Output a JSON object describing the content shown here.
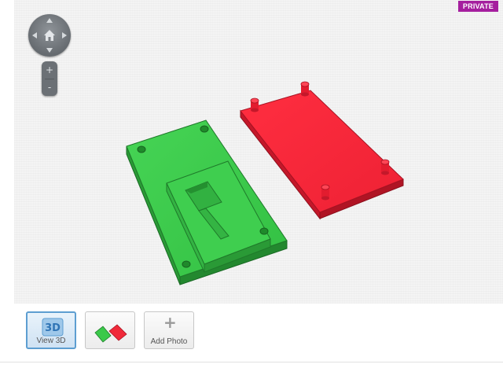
{
  "badge": {
    "private": "PRIVATE"
  },
  "navigation": {
    "home_icon": "home-icon",
    "zoom_in": "+",
    "zoom_out": "-"
  },
  "models": {
    "green_part_color": "#3bc94a",
    "red_part_color": "#f02a3a"
  },
  "thumbnails": [
    {
      "label": "View 3D",
      "icon": "3d-view-icon",
      "active": true
    },
    {
      "label": "",
      "icon": "model-preview-thumbnail",
      "active": false
    },
    {
      "label": "Add Photo",
      "icon": "plus-icon",
      "active": false
    }
  ],
  "view3d_text": "3D"
}
